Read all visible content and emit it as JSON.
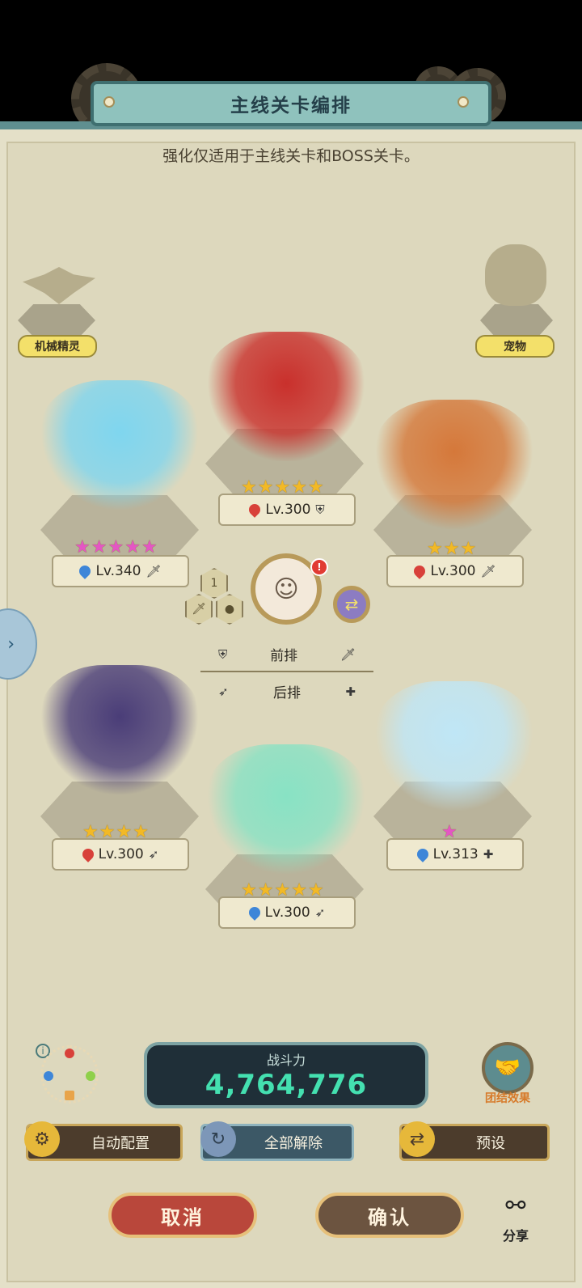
{
  "title": "主线关卡编排",
  "subtitle": "强化仅适用于主线关卡和BOSS关卡。",
  "side_slots": {
    "left_label": "机械精灵",
    "right_label": "宠物"
  },
  "heroes": [
    {
      "name": "hero-dragon",
      "stars": 5,
      "star_color": "#e456c4",
      "element": "water",
      "level": "Lv.340",
      "role": "sword",
      "color": "#7fd6ef"
    },
    {
      "name": "hero-masked-lady",
      "stars": 5,
      "star_color": "#f2b926",
      "element": "fire",
      "level": "Lv.300",
      "role": "shield",
      "color": "#c9302c"
    },
    {
      "name": "hero-valkyrie",
      "stars": 3,
      "star_color": "#f2b926",
      "element": "fire",
      "level": "Lv.300",
      "role": "sword",
      "color": "#d5783a"
    },
    {
      "name": "hero-medusa",
      "stars": 4,
      "star_color": "#f2b926",
      "element": "fire",
      "level": "Lv.300",
      "role": "bow",
      "color": "#4a3d78"
    },
    {
      "name": "hero-elf-mage",
      "stars": 5,
      "star_color": "#f2b926",
      "element": "water",
      "level": "Lv.300",
      "role": "bow",
      "color": "#88e2c4"
    },
    {
      "name": "hero-ice-princess",
      "stars": 1,
      "star_color": "#e456c4",
      "element": "water",
      "level": "Lv.313",
      "role": "heal",
      "color": "#bfe6f6"
    }
  ],
  "formation": {
    "front_label": "前排",
    "back_label": "后排",
    "slot_count": "1",
    "badge": "!"
  },
  "power": {
    "label": "战斗力",
    "value": "4,764,776"
  },
  "buttons": {
    "auto": "自动配置",
    "clear_all": "全部解除",
    "preset": "预设",
    "cancel": "取消",
    "confirm": "确认",
    "team_effect": "团结效果",
    "share": "分享"
  },
  "icons": {
    "sword": "🗡",
    "shield": "⛨",
    "bow": "➶",
    "heal": "✚",
    "star": "★",
    "chevron": "›",
    "swap": "⇄",
    "info": "i"
  },
  "colors": {
    "fire": "#d8413a",
    "water": "#3e86d8",
    "panel": "#e4e0c8",
    "power_value": "#44e0b0"
  }
}
